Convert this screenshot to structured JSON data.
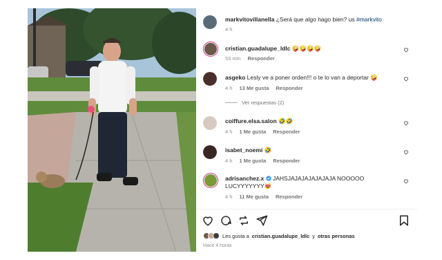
{
  "post": {
    "author": "markvitovillanella",
    "caption": "¿Será que algo hago bien? us",
    "hashtag": "#markvito",
    "time": "4 h"
  },
  "comments": [
    {
      "user": "cristian.guadalupe_ldlc",
      "text": "🤪🤪🤪🤪",
      "time": "53 min",
      "likes": "",
      "reply": "Responder",
      "ring": true,
      "avatar_color": "#6b5a4a"
    },
    {
      "user": "asgeko",
      "text": "Lesly ve a poner orden!!! o te lo van a deportar 🤪",
      "time": "4 h",
      "likes": "13 Me gusta",
      "reply": "Responder",
      "ring": false,
      "avatar_color": "#4a2f2a"
    },
    {
      "user": "coiffure.elsa.salon",
      "text": "🤣🤣",
      "time": "4 h",
      "likes": "1 Me gusta",
      "reply": "Responder",
      "ring": false,
      "avatar_color": "#d8c9c0"
    },
    {
      "user": "isabet_noemi",
      "text": "🤣",
      "time": "4 h",
      "likes": "1 Me gusta",
      "reply": "Responder",
      "ring": false,
      "avatar_color": "#3b2622"
    },
    {
      "user": "adrisanchez.x",
      "text": "JAHSJAJAJAJAJAJAJA NOOOOO LUCYYYYYYY😻",
      "time": "4 h",
      "likes": "11 Me gusta",
      "reply": "Responder",
      "ring": true,
      "verified": true,
      "avatar_color": "#7a9a3a"
    }
  ],
  "view_replies": "Ver respuestas (2)",
  "likes_summary": {
    "prefix": "Les gusta a",
    "user": "cristian.guadalupe_ldlc",
    "suffix": "y",
    "others": "otras personas"
  },
  "timestamp": "Hace 4 horas",
  "icons": [
    "heart-icon",
    "comment-icon",
    "repost-icon",
    "share-icon",
    "bookmark-icon"
  ]
}
